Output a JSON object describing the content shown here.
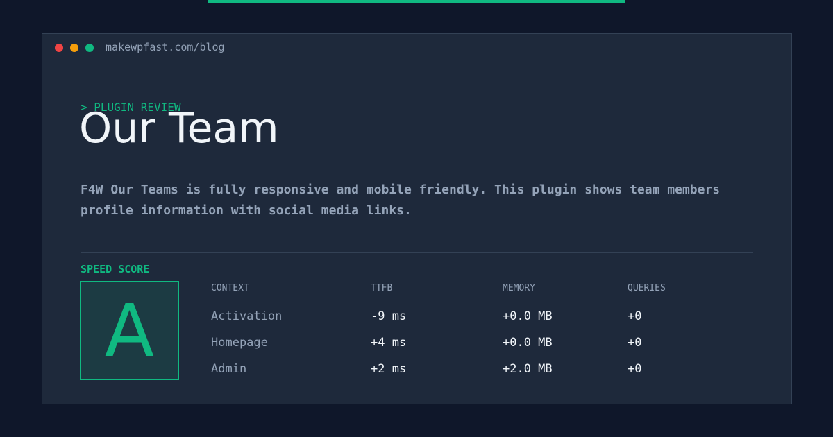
{
  "colors": {
    "background": "#0f172a",
    "window": "#1e293b",
    "border": "#334155",
    "accent": "#10b981",
    "dot_red": "#ef4444",
    "dot_yellow": "#f59e0b",
    "dot_green": "#10b981",
    "text_primary": "#f1f5f9",
    "text_muted": "#94a3b8",
    "grade_bg": "#1c3b43"
  },
  "window": {
    "url": "makewpfast.com/blog"
  },
  "header": {
    "kicker": "> PLUGIN REVIEW",
    "title": "Our Team"
  },
  "description": "F4W Our Teams is fully responsive and mobile friendly. This plugin shows team members profile information with social media links.",
  "speed_score": {
    "label": "SPEED SCORE",
    "grade": "A"
  },
  "table": {
    "columns": [
      "CONTEXT",
      "TTFB",
      "MEMORY",
      "QUERIES"
    ],
    "rows": [
      {
        "context": "Activation",
        "ttfb": "-9 ms",
        "memory": "+0.0 MB",
        "queries": "+0"
      },
      {
        "context": "Homepage",
        "ttfb": "+4 ms",
        "memory": "+0.0 MB",
        "queries": "+0"
      },
      {
        "context": "Admin",
        "ttfb": "+2 ms",
        "memory": "+2.0 MB",
        "queries": "+0"
      }
    ]
  }
}
